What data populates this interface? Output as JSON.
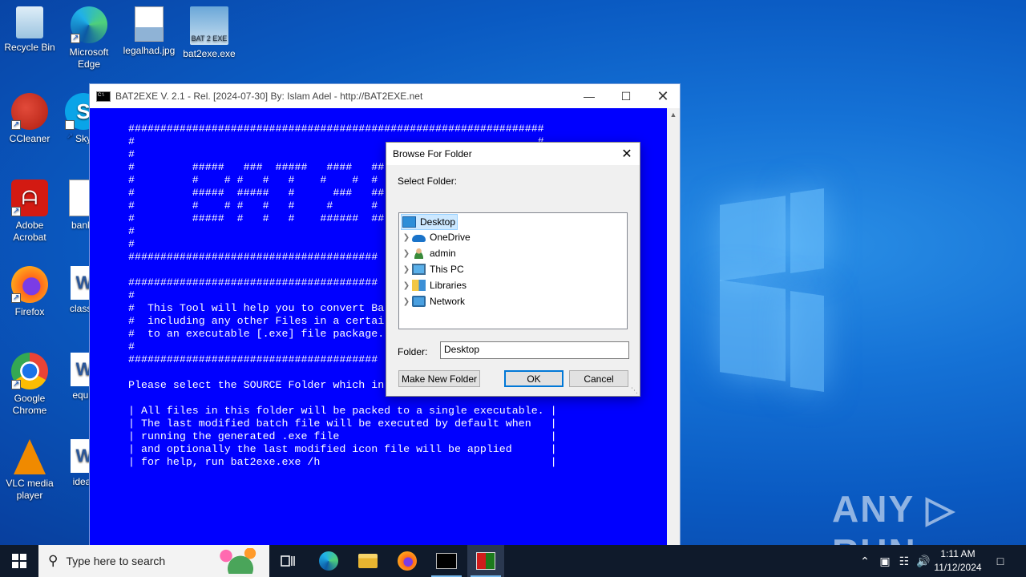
{
  "desktop": {
    "icons": [
      {
        "label": "Recycle Bin"
      },
      {
        "label": "Microsoft Edge"
      },
      {
        "label": "legalhad.jpg"
      },
      {
        "label": "bat2exe.exe"
      },
      {
        "label": "CCleaner"
      },
      {
        "label": "Sky"
      },
      {
        "label": "Adobe Acrobat"
      },
      {
        "label": "bankk"
      },
      {
        "label": "Firefox"
      },
      {
        "label": "classic"
      },
      {
        "label": "Google Chrome"
      },
      {
        "label": "equip"
      },
      {
        "label": "VLC media player"
      },
      {
        "label": "ideas"
      }
    ],
    "watermark": "ANY ▷ RUN"
  },
  "console": {
    "title": "BAT2EXE V. 2.1 - Rel. [2024-07-30] By: Islam Adel - http://BAT2EXE.net",
    "lines": [
      "#################################################################",
      "#                                                               #",
      "#                                                               #",
      "#         #####   ###  #####   ####   ##",
      "#         #    # #   #   #    #    #  #  #",
      "#         #####  #####   #      ###   ##",
      "#         #    # #   #   #     #      #",
      "#         #####  #   #   #    ######  ##",
      "#",
      "#",
      "#######################################",
      "",
      "#######################################",
      "#",
      "#  This Tool will help you to convert Ba",
      "#  including any other Files in a certai",
      "#  to an executable [.exe] file package.",
      "#",
      "#######################################",
      "",
      "Please select the SOURCE Folder which in",
      "",
      "| All files in this folder will be packed to a single executable. |",
      "| The last modified batch file will be executed by default when   |",
      "| running the generated .exe file                                 |",
      "| and optionally the last modified icon file will be applied      |",
      "| for help, run bat2exe.exe /h                                    |"
    ]
  },
  "dialog": {
    "title": "Browse For Folder",
    "prompt": "Select Folder:",
    "tree": [
      {
        "label": "Desktop"
      },
      {
        "label": "OneDrive"
      },
      {
        "label": "admin"
      },
      {
        "label": "This PC"
      },
      {
        "label": "Libraries"
      },
      {
        "label": "Network"
      }
    ],
    "folder_label": "Folder:",
    "folder_value": "Desktop",
    "make_new_folder": "Make New Folder",
    "ok": "OK",
    "cancel": "Cancel"
  },
  "taskbar": {
    "search_placeholder": "Type here to search",
    "time": "1:11 AM",
    "date": "11/12/2024"
  }
}
